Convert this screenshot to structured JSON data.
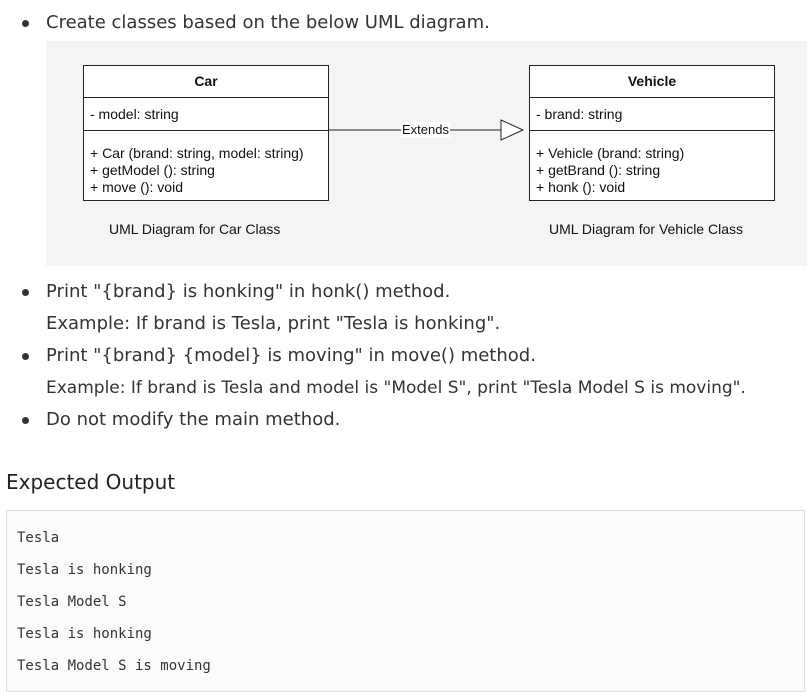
{
  "bullets": {
    "b1": "Create classes based on the below UML diagram.",
    "b2": "Print \"{brand} is honking\" in honk() method.",
    "b2_example": "Example: If brand is Tesla, print \"Tesla is honking\".",
    "b3": "Print \"{brand} {model} is moving\" in move() method.",
    "b3_example": "Example: If brand is Tesla and model is \"Model S\", print \"Tesla Model S is moving\".",
    "b4": "Do not modify the main method."
  },
  "uml": {
    "car": {
      "name": "Car",
      "attribute": "- model: string",
      "operations": [
        "+ Car (brand: string, model: string)",
        "+ getModel (): string",
        "+ move (): void"
      ],
      "caption": "UML Diagram for Car Class"
    },
    "vehicle": {
      "name": "Vehicle",
      "attribute": "- brand: string",
      "operations": [
        "+ Vehicle (brand: string)",
        "+ getBrand (): string",
        "+ honk (): void"
      ],
      "caption": "UML Diagram for Vehicle Class"
    },
    "relation_label": "Extends"
  },
  "expected_output": {
    "title": "Expected Output",
    "lines": [
      "Tesla",
      "Tesla is honking",
      "Tesla Model S",
      "Tesla is honking",
      "Tesla Model S is moving"
    ]
  }
}
